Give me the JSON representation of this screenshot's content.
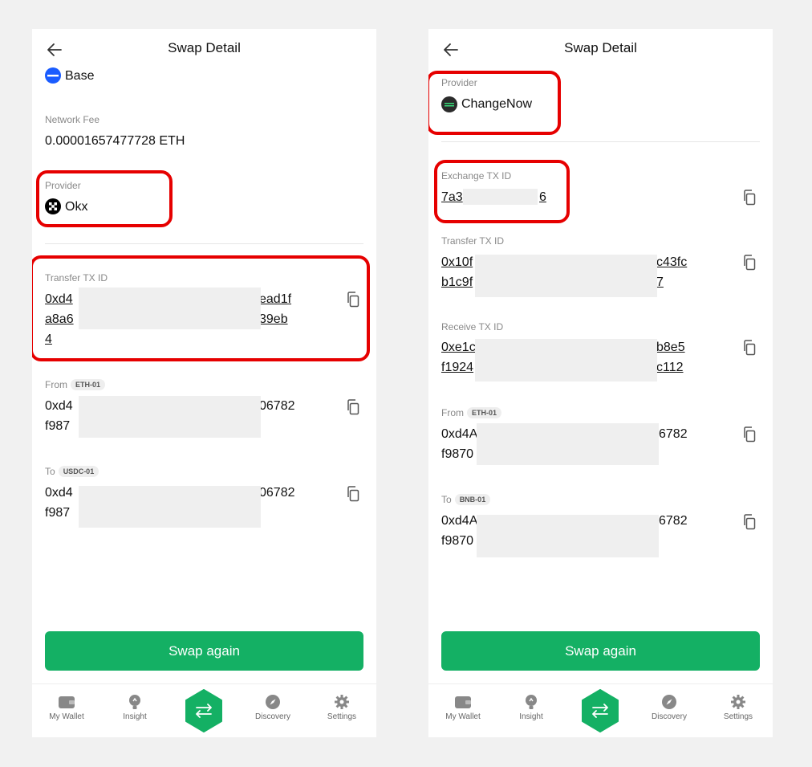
{
  "left": {
    "title": "Swap Detail",
    "network_name": "Base",
    "network_fee_label": "Network Fee",
    "network_fee_value": "0.00001657477728 ETH",
    "provider_label": "Provider",
    "provider_name": "Okx",
    "transfer_label": "Transfer TX ID",
    "transfer_line1_start": "0xd4",
    "transfer_line1_end": "ead1f",
    "transfer_line2_start": "a8a6",
    "transfer_line2_end": "39eb",
    "transfer_line3": "4",
    "from_label": "From",
    "from_chip": "ETH-01",
    "from_line1_start": "0xd4",
    "from_line1_end": "06782",
    "from_line2_start": "f987",
    "to_label": "To",
    "to_chip": "USDC-01",
    "to_line1_start": "0xd4",
    "to_line1_end": "06782",
    "to_line2_start": "f987",
    "button": "Swap again"
  },
  "right": {
    "title": "Swap Detail",
    "provider_label": "Provider",
    "provider_name": "ChangeNow",
    "exchange_label": "Exchange TX ID",
    "exchange_start": "7a3",
    "exchange_end": "6",
    "transfer_label": "Transfer TX ID",
    "transfer_line1_start": "0x10f",
    "transfer_line1_end": "c43fc",
    "transfer_line2_start": "b1c9f",
    "transfer_line2_end": "7",
    "receive_label": "Receive TX ID",
    "receive_line1_start": "0xe1c",
    "receive_line1_end": "b8e5",
    "receive_line2_start": "f1924",
    "receive_line2_end": "c112",
    "from_label": "From",
    "from_chip": "ETH-01",
    "from_line1_start": "0xd4A",
    "from_line1_end": "6782",
    "from_line2_start": "f9870",
    "to_label": "To",
    "to_chip": "BNB-01",
    "to_line1_start": "0xd4A",
    "to_line1_end": "6782",
    "to_line2_start": "f9870",
    "button": "Swap again"
  },
  "nav": {
    "wallet": "My Wallet",
    "insight": "Insight",
    "discovery": "Discovery",
    "settings": "Settings"
  },
  "colors": {
    "accent": "#14b064",
    "highlight": "#e60000",
    "base_blue": "#1a5cff"
  },
  "icons": [
    "back-arrow-icon",
    "copy-icon",
    "wallet-icon",
    "insight-icon",
    "swap-icon",
    "discovery-icon",
    "settings-icon",
    "base-network-icon",
    "okx-icon",
    "changenow-icon"
  ]
}
